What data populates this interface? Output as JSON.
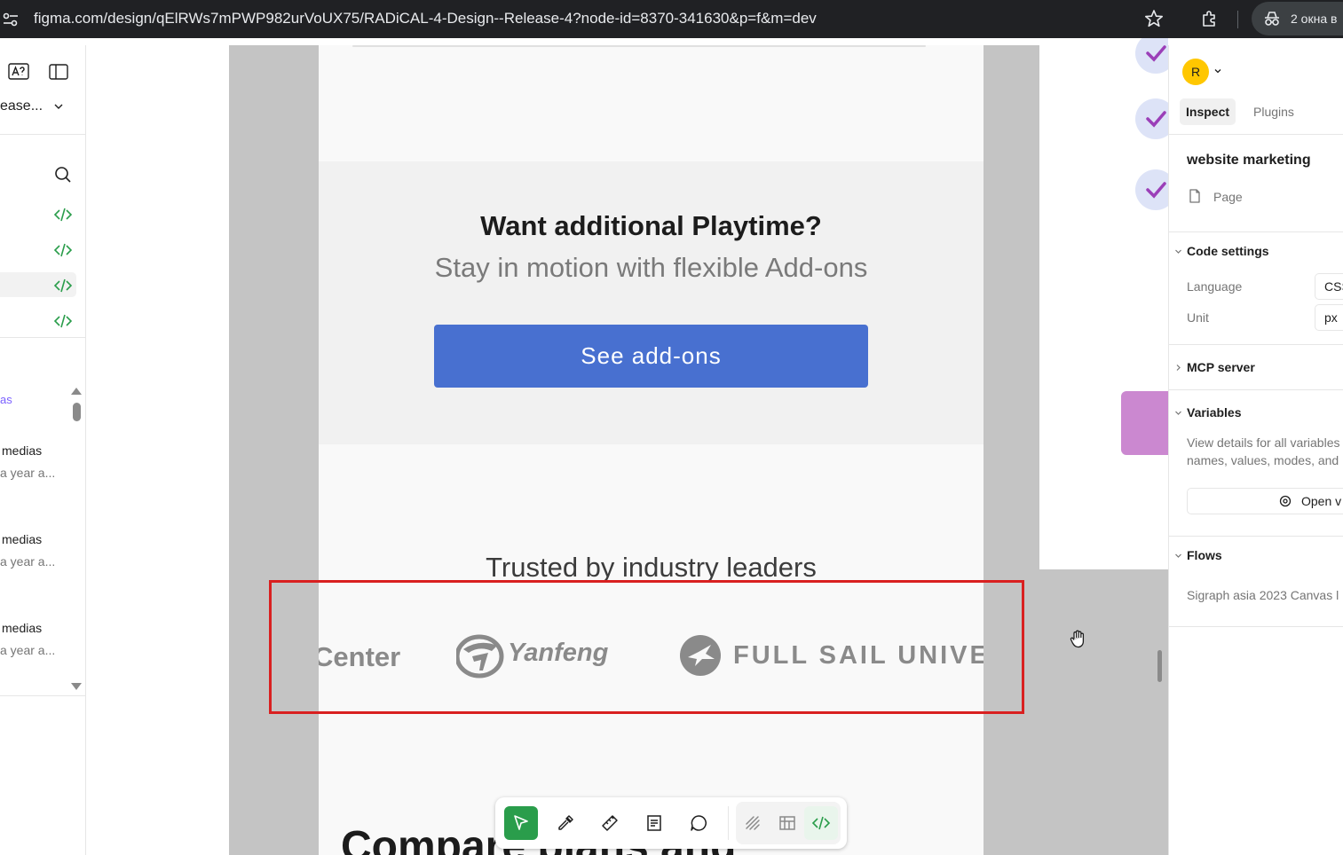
{
  "browser": {
    "url": "figma.com/design/qElRWs7mPWP982urVoUX75/RADiCAL-4-Design--Release-4?node-id=8370-341630&p=f&m=dev",
    "incognito_label": "2 окна в"
  },
  "left_panel": {
    "file_name": "ease...",
    "section_title": "as",
    "items": [
      {
        "title": "medias",
        "subtitle": "a year a..."
      },
      {
        "title": "medias",
        "subtitle": "a year a..."
      },
      {
        "title": "medias",
        "subtitle": "a year a..."
      }
    ]
  },
  "canvas": {
    "addon_title": "Want additional Playtime?",
    "addon_subtitle": "Stay in motion with flexible Add-ons",
    "addon_button": "See add-ons",
    "trusted_title": "Trusted by industry leaders",
    "logos": {
      "logo1": "Center",
      "logo2": "Yanfeng",
      "logo3": "FULL SAIL UNIVERS"
    },
    "compare_title": "Compare plans and"
  },
  "right_panel": {
    "avatar_initial": "R",
    "tabs": {
      "inspect": "Inspect",
      "plugins": "Plugins"
    },
    "selection_title": "website marketing",
    "selection_type": "Page",
    "code_settings": {
      "title": "Code settings",
      "language_label": "Language",
      "language_value": "CSS",
      "unit_label": "Unit",
      "unit_value": "px"
    },
    "mcp_title": "MCP server",
    "variables": {
      "title": "Variables",
      "desc_line1": "View details for all variables",
      "desc_line2": "names, values, modes, and",
      "open_button": "Open v"
    },
    "flows": {
      "title": "Flows",
      "item": "Sigraph asia 2023 Canvas l"
    }
  },
  "colors": {
    "accent_green": "#2a9d4b",
    "addon_button_blue": "#4870d0",
    "highlight_red": "#d92020",
    "code_icon_green": "#2a9d4b"
  }
}
